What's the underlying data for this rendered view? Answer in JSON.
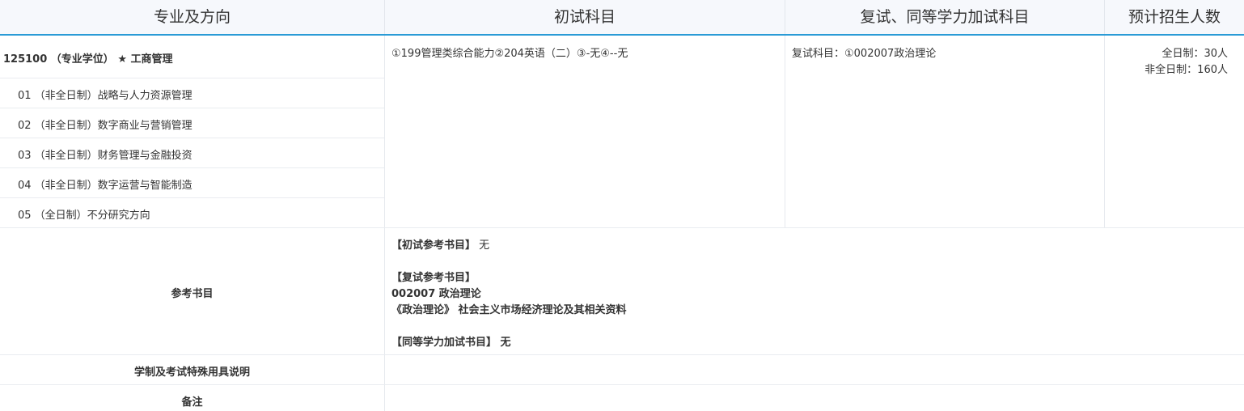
{
  "header": {
    "major": "专业及方向",
    "initial_exam": "初试科目",
    "re_exam": "复试、同等学力加试科目",
    "enrollment": "预计招生人数"
  },
  "program": {
    "title": "125100 （专业学位） ★ 工商管理",
    "directions": [
      "01 （非全日制）战略与人力资源管理",
      "02 （非全日制）数字商业与营销管理",
      "03 （非全日制）财务管理与金融投资",
      "04 （非全日制）数字运营与智能制造",
      "05 （全日制）不分研究方向"
    ],
    "initial_subjects": "①199管理类综合能力②204英语（二）③-无④--无",
    "re_subjects": "复试科目：①002007政治理论",
    "enrollment": {
      "full_time": "全日制：30人",
      "part_time": "非全日制：160人"
    }
  },
  "reference": {
    "label": "参考书目",
    "initial_head": "【初试参考书目】",
    "initial_value": "无",
    "re_head": "【复试参考书目】",
    "re_code": "002007 政治理论",
    "re_book": "《政治理论》 社会主义市场经济理论及其相关资料",
    "equiv_head": "【同等学力加试书目】",
    "equiv_value": "无"
  },
  "schooling": {
    "label": "学制及考试特殊用具说明"
  },
  "remarks": {
    "label": "备注"
  }
}
